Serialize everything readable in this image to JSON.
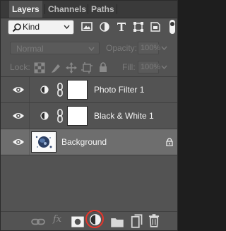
{
  "tabs": [
    {
      "label": "Layers",
      "active": true
    },
    {
      "label": "Channels",
      "active": false
    },
    {
      "label": "Paths",
      "active": false
    }
  ],
  "filter": {
    "kind_label": "Kind",
    "filter_icons": [
      "pixel-filter-icon",
      "adjustment-filter-icon",
      "type-filter-icon",
      "shape-filter-icon",
      "smart-object-filter-icon"
    ]
  },
  "blend": {
    "mode": "Normal",
    "opacity_label": "Opacity:",
    "opacity_value": "100%"
  },
  "lock": {
    "label": "Lock:",
    "fill_label": "Fill:",
    "fill_value": "100%"
  },
  "layers": [
    {
      "name": "Photo Filter 1",
      "type": "adjustment",
      "visible": true,
      "selected": false
    },
    {
      "name": "Black & White 1",
      "type": "adjustment",
      "visible": true,
      "selected": false
    },
    {
      "name": "Background",
      "type": "pixel",
      "visible": true,
      "selected": true,
      "locked": true
    }
  ],
  "footer_icons": [
    "link-layers-icon",
    "fx-icon",
    "add-mask-icon",
    "new-adjustment-layer-icon",
    "new-group-icon",
    "new-layer-icon",
    "trash-icon"
  ],
  "footer_fx_label": "fx",
  "colors": {
    "panel_bg": "#535353",
    "selected_row": "#6e6e6e",
    "highlight_ring": "#e6352b"
  }
}
